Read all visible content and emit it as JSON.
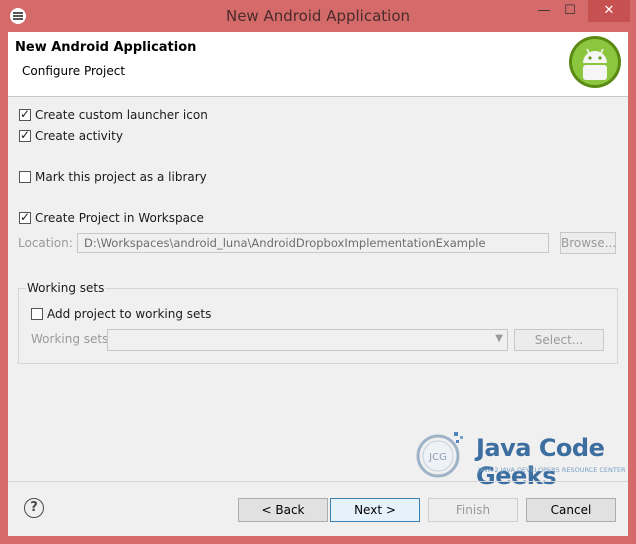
{
  "window": {
    "title": "New Android Application"
  },
  "titlebar": {
    "minimize_glyph": "—",
    "maximize_glyph": "☐",
    "close_glyph": "✕"
  },
  "banner": {
    "title": "New Android Application",
    "subtitle": "Configure Project"
  },
  "options": {
    "launcher_icon": {
      "label": "Create custom launcher icon",
      "checked": true
    },
    "activity": {
      "label": "Create activity",
      "checked": true
    },
    "library": {
      "label": "Mark this project as a library",
      "checked": false
    },
    "workspace": {
      "label": "Create Project in Workspace",
      "checked": true
    }
  },
  "location": {
    "label": "Location:",
    "value": "D:\\Workspaces\\android_luna\\AndroidDropboxImplementationExample",
    "browse_label": "Browse..."
  },
  "working_sets": {
    "group_title": "Working sets",
    "add_label": "Add project to working sets",
    "add_checked": false,
    "sets_label": "Working sets:",
    "select_label": "Select..."
  },
  "watermark": {
    "brand": "Java Code Geeks",
    "tagline": "JAVA 2 JAVA DEVELOPERS RESOURCE CENTER",
    "badge": "JCG"
  },
  "buttons": {
    "help": "?",
    "back": "< Back",
    "next": "Next >",
    "finish": "Finish",
    "cancel": "Cancel"
  }
}
